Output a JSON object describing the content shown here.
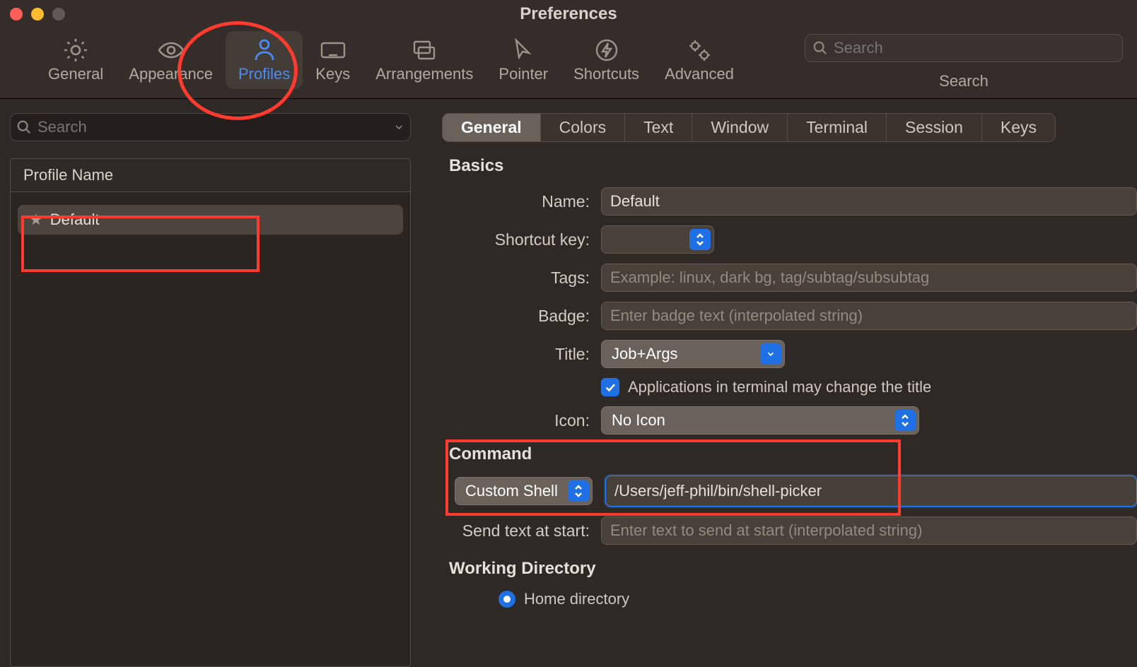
{
  "window": {
    "title": "Preferences"
  },
  "toolbar": {
    "search_placeholder": "Search",
    "search_label": "Search",
    "tabs": [
      {
        "id": "general",
        "label": "General",
        "icon": "gear-icon"
      },
      {
        "id": "appearance",
        "label": "Appearance",
        "icon": "eye-icon"
      },
      {
        "id": "profiles",
        "label": "Profiles",
        "icon": "person-icon",
        "selected": true
      },
      {
        "id": "keys",
        "label": "Keys",
        "icon": "keyboard-icon"
      },
      {
        "id": "arrangements",
        "label": "Arrangements",
        "icon": "windows-icon"
      },
      {
        "id": "pointer",
        "label": "Pointer",
        "icon": "cursor-icon"
      },
      {
        "id": "shortcuts",
        "label": "Shortcuts",
        "icon": "bolt-icon"
      },
      {
        "id": "advanced",
        "label": "Advanced",
        "icon": "gears-icon"
      }
    ]
  },
  "sidebar": {
    "search_placeholder": "Search",
    "header": "Profile Name",
    "items": [
      {
        "name": "Default",
        "starred": true,
        "selected": true
      }
    ]
  },
  "profile_tabs": [
    {
      "label": "General",
      "active": true
    },
    {
      "label": "Colors"
    },
    {
      "label": "Text"
    },
    {
      "label": "Window"
    },
    {
      "label": "Terminal"
    },
    {
      "label": "Session"
    },
    {
      "label": "Keys"
    }
  ],
  "sections": {
    "basics": {
      "title": "Basics",
      "name_label": "Name:",
      "name_value": "Default",
      "shortcut_label": "Shortcut key:",
      "shortcut_value": "",
      "tags_label": "Tags:",
      "tags_placeholder": "Example: linux, dark bg, tag/subtag/subsubtag",
      "badge_label": "Badge:",
      "badge_placeholder": "Enter badge text (interpolated string)",
      "title_label": "Title:",
      "title_value": "Job+Args",
      "apps_change_title": "Applications in terminal may change the title",
      "apps_change_title_checked": true,
      "icon_label": "Icon:",
      "icon_value": "No Icon"
    },
    "command": {
      "title": "Command",
      "shell_type": "Custom Shell",
      "shell_path": "/Users/jeff-phil/bin/shell-picker",
      "send_text_label": "Send text at start:",
      "send_text_placeholder": "Enter text to send at start (interpolated string)"
    },
    "working_dir": {
      "title": "Working Directory",
      "option_home": "Home directory",
      "option_home_selected": true
    }
  }
}
